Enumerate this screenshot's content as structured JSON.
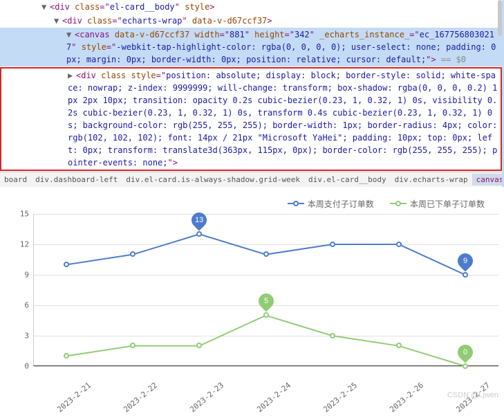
{
  "tree": {
    "line1": {
      "class": "el-card__body",
      "styleAttr": "style"
    },
    "line2": {
      "class": "echarts-wrap",
      "dataV": "data-v-d67ccf37"
    },
    "canvas": {
      "dataV": "data-v-d67ccf37",
      "width": "881",
      "height": "342",
      "instance": "ec_1677568030217",
      "style": "-webkit-tap-highlight-color: rgba(0, 0, 0, 0); user-select: none; padding: 0px; margin: 0px; border-width: 0px; position: relative; cursor: default;",
      "endComment": "== $0"
    },
    "tooltipDiv": {
      "style": "position: absolute; display: block; border-style: solid; white-space: nowrap; z-index: 9999999; will-change: transform; box-shadow: rgba(0, 0, 0, 0.2) 1px 2px 10px; transition: opacity 0.2s cubic-bezier(0.23, 1, 0.32, 1) 0s, visibility 0.2s cubic-bezier(0.23, 1, 0.32, 1) 0s, transform 0.4s cubic-bezier(0.23, 1, 0.32, 1) 0s; background-color: rgb(255, 255, 255); border-width: 1px; border-radius: 4px; color: rgb(102, 102, 102); font: 14px / 21px \"Microsoft YaHei\"; padding: 10px; top: 0px; left: 0px; transform: translate3d(363px, 115px, 0px); border-color: rgb(255, 255, 255); pointer-events: none;"
    }
  },
  "breadcrumb": {
    "items": [
      "board",
      "div.dashboard-left",
      "div.el-card.is-always-shadow.grid-week",
      "div.el-card__body",
      "div.echarts-wrap",
      "canvas"
    ],
    "dots": "…"
  },
  "chart": {
    "legend": {
      "series1": {
        "label": "本周支付子订单数",
        "color": "#4e7ccd"
      },
      "series2": {
        "label": "本周已下单子订单数",
        "color": "#91cc75"
      }
    }
  },
  "chart_data": {
    "type": "line",
    "categories": [
      "2023-2-21",
      "2023-2-22",
      "2023-2-23",
      "2023-2-24",
      "2023-2-25",
      "2023-2-26",
      "2023-2-27"
    ],
    "series": [
      {
        "name": "本周支付子订单数",
        "color": "#4e7ccd",
        "values": [
          10,
          11,
          13,
          11,
          12,
          12,
          9
        ]
      },
      {
        "name": "本周已下单子订单数",
        "color": "#91cc75",
        "values": [
          1,
          2,
          2,
          5,
          3,
          2,
          0
        ]
      }
    ],
    "markers": [
      {
        "series": 0,
        "index": 2,
        "label": "13"
      },
      {
        "series": 0,
        "index": 6,
        "label": "9"
      },
      {
        "series": 1,
        "index": 3,
        "label": "5"
      },
      {
        "series": 1,
        "index": 6,
        "label": "0"
      }
    ],
    "yticks": [
      0,
      3,
      6,
      9,
      12,
      15
    ],
    "ylim": [
      0,
      15
    ]
  },
  "watermark": "CSDN @Ljwen"
}
